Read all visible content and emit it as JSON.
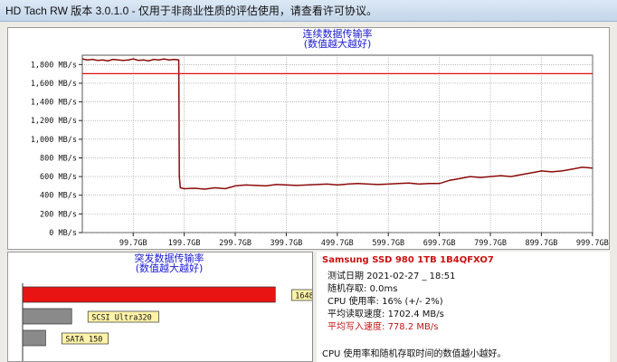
{
  "window": {
    "title": "HD Tach RW 版本 3.0.1.0  - 仅用于非商业性质的评估使用，请查看许可协议。"
  },
  "colors": {
    "read_line": "#8b0a0a",
    "average_line": "#e01010",
    "grid": "#9a9a9a",
    "title_blue": "#1a1ad6",
    "burst_bar": "#e81414",
    "ref_bar": "#8a8a8a",
    "label_bg": "#fff3a8"
  },
  "chart_data": [
    {
      "type": "line",
      "title": "连续数据传输率",
      "subtitle": "(数值越大越好)",
      "ylabel_unit": "MB/s",
      "ylim": [
        0,
        1900
      ],
      "yticks": [
        "0 MB/s",
        "200 MB/s",
        "400 MB/s",
        "600 MB/s",
        "800 MB/s",
        "1,000 MB/s",
        "1,200 MB/s",
        "1,400 MB/s",
        "1,600 MB/s",
        "1,800 MB/s"
      ],
      "ytick_values": [
        0,
        200,
        400,
        600,
        800,
        1000,
        1200,
        1400,
        1600,
        1800
      ],
      "xlim": [
        0,
        1000
      ],
      "xticks": [
        "99.7GB",
        "199.7GB",
        "299.7GB",
        "399.7GB",
        "499.7GB",
        "599.7GB",
        "699.7GB",
        "799.7GB",
        "899.7GB",
        "999.7GB"
      ],
      "xtick_values": [
        99.7,
        199.7,
        299.7,
        399.7,
        499.7,
        599.7,
        699.7,
        799.7,
        899.7,
        999.7
      ],
      "grid": true,
      "series": [
        {
          "role": "read",
          "x": [
            0,
            10,
            20,
            30,
            40,
            50,
            60,
            70,
            80,
            90,
            100,
            110,
            120,
            130,
            140,
            150,
            160,
            170,
            180,
            189,
            190,
            192,
            200,
            220,
            240,
            260,
            280,
            300,
            320,
            340,
            360,
            380,
            400,
            420,
            440,
            460,
            480,
            500,
            520,
            540,
            560,
            580,
            600,
            620,
            640,
            660,
            680,
            700,
            720,
            740,
            760,
            780,
            800,
            820,
            840,
            860,
            880,
            900,
            920,
            940,
            960,
            980,
            1000
          ],
          "values": [
            1860,
            1850,
            1855,
            1845,
            1850,
            1840,
            1855,
            1850,
            1845,
            1850,
            1860,
            1845,
            1850,
            1840,
            1855,
            1850,
            1860,
            1850,
            1855,
            1850,
            600,
            480,
            470,
            475,
            465,
            480,
            470,
            500,
            510,
            505,
            500,
            515,
            510,
            505,
            510,
            515,
            520,
            510,
            520,
            525,
            520,
            515,
            520,
            525,
            530,
            520,
            525,
            525,
            560,
            580,
            600,
            590,
            600,
            610,
            600,
            620,
            640,
            660,
            650,
            660,
            680,
            700,
            690
          ]
        },
        {
          "role": "average",
          "x": [
            0,
            1000
          ],
          "values": [
            1702.4,
            1702.4
          ]
        }
      ]
    },
    {
      "type": "bar",
      "title": "突发数据传输率",
      "subtitle": "(数值越大越好)",
      "categories": [
        "1648.7 MB/s",
        "SCSI Ultra320",
        "SATA 150"
      ],
      "values": [
        1648.7,
        320,
        150
      ],
      "xlim": [
        0,
        1700
      ]
    }
  ],
  "info": {
    "title": "Samsung SSD 980 1TB 1B4QFXO7",
    "lines": [
      {
        "label": "测试日期",
        "value": "2021-02-27 _ 18:51"
      },
      {
        "label": "随机存取:",
        "value": "0.0ms"
      },
      {
        "label": "CPU 使用率:",
        "value": "16% (+/- 2%)"
      },
      {
        "label": "平均读取速度:",
        "value": "1702.4 MB/s"
      },
      {
        "label": "平均写入速度:",
        "value": "778.2 MB/s"
      }
    ],
    "note": "CPU 使用率和随机存取时间的数值越小越好。"
  }
}
